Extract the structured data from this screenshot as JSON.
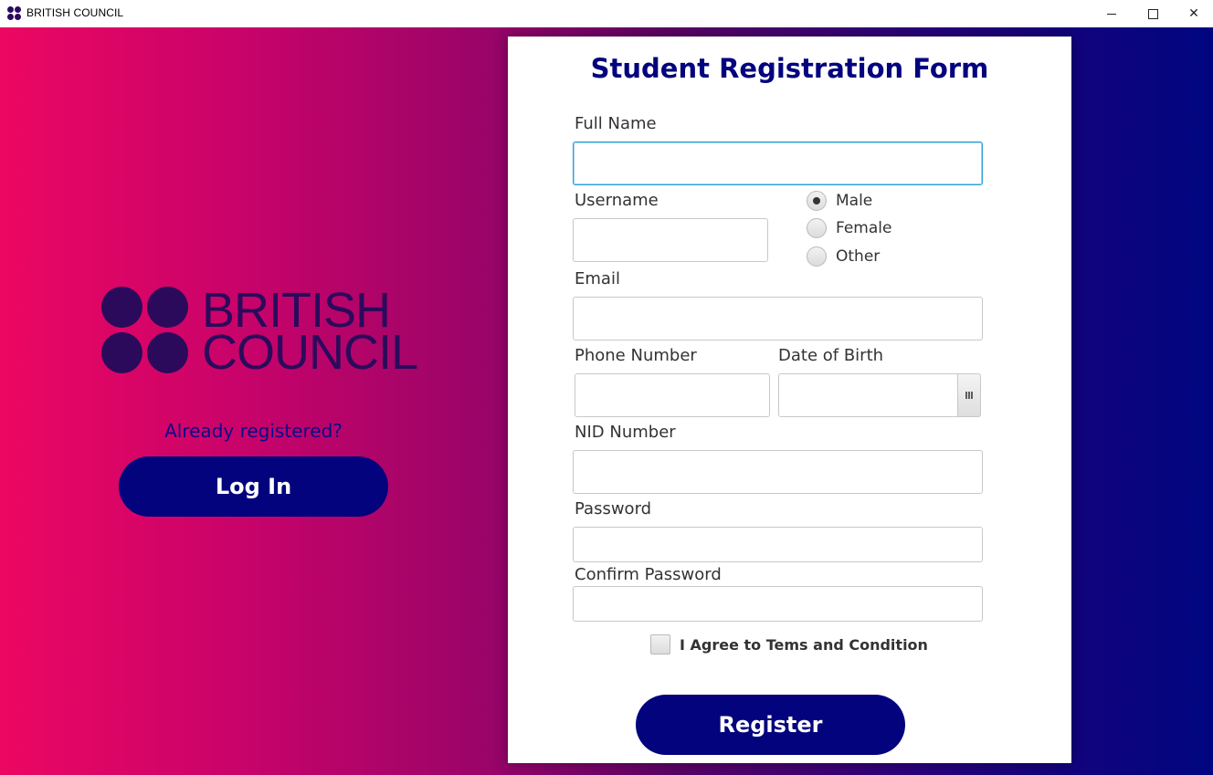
{
  "window": {
    "title": "BRITISH COUNCIL",
    "minimize_glyph": "–",
    "maximize_glyph": "□",
    "close_glyph": "✕"
  },
  "brand": {
    "logo_line1": "BRITISH",
    "logo_line2": "COUNCIL",
    "logo_color": "#2b0a5c"
  },
  "left_panel": {
    "already_registered": "Already registered?",
    "login_label": "Log In"
  },
  "form": {
    "title": "Student Registration Form",
    "full_name": {
      "label": "Full Name",
      "value": ""
    },
    "username": {
      "label": "Username",
      "value": ""
    },
    "gender": {
      "options": [
        "Male",
        "Female",
        "Other"
      ],
      "selected": "Male"
    },
    "email": {
      "label": "Email",
      "value": ""
    },
    "phone": {
      "label": "Phone Number",
      "value": ""
    },
    "dob": {
      "label": "Date of Birth",
      "value": ""
    },
    "nid": {
      "label": "NID Number",
      "value": ""
    },
    "password": {
      "label": "Password",
      "value": ""
    },
    "confirm_password": {
      "label": "Confirm Password",
      "value": ""
    },
    "agree_label": "I Agree to Tems and Condition",
    "agree_checked": false,
    "register_label": "Register"
  },
  "colors": {
    "accent": "#03037e",
    "gradient_start": "#ec0762",
    "gradient_end": "#000680",
    "focus_border": "#2a9fd8"
  }
}
